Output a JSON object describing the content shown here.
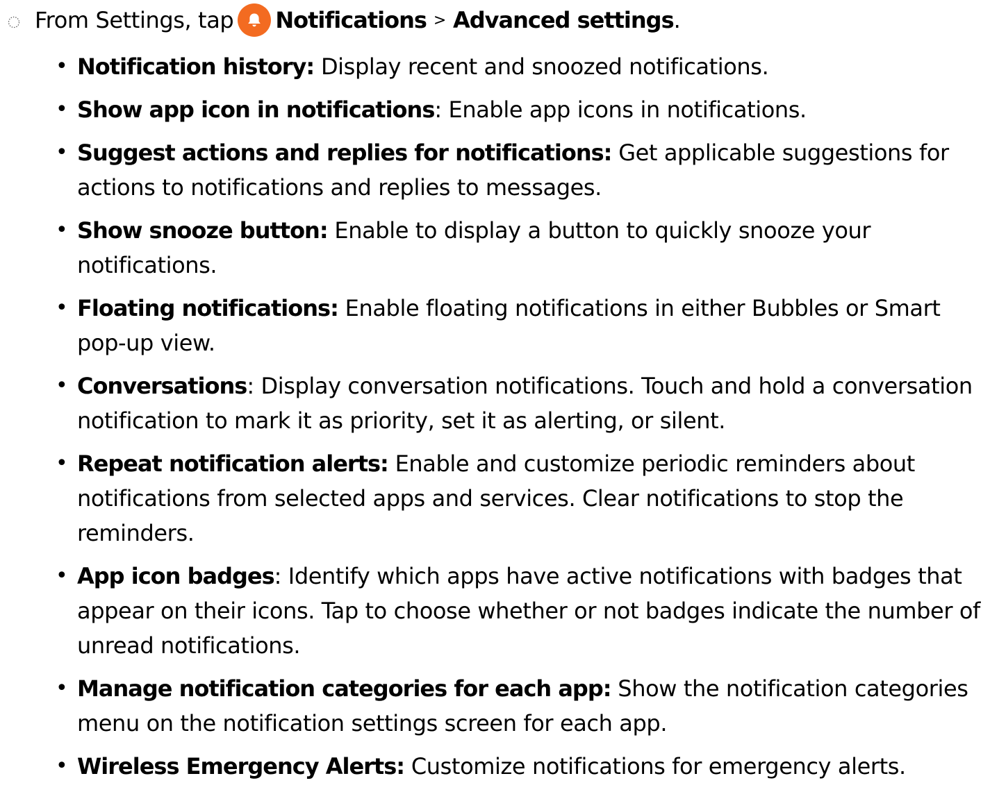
{
  "step": {
    "marker_icon": "dotted-circle-icon",
    "prefix": "From Settings, tap",
    "icon": "notifications-bell-icon",
    "icon_color": "#f36b21",
    "item1": "Notifications",
    "separator": ">",
    "item2": "Advanced settings",
    "end": "."
  },
  "bullets": [
    {
      "term": "Notification history:",
      "desc": " Display recent and snoozed notifications."
    },
    {
      "term": "Show app icon in notifications",
      "desc": ": Enable app icons in notifications."
    },
    {
      "term": "Suggest actions and replies for notifications:",
      "desc": " Get applicable suggestions for actions to notifications and replies to messages."
    },
    {
      "term": "Show snooze button:",
      "desc": " Enable to display a button to quickly snooze your notifications."
    },
    {
      "term": "Floating notifications:",
      "desc": " Enable floating notifications in either Bubbles or Smart pop-up view."
    },
    {
      "term": "Conversations",
      "desc": ": Display conversation notifications. Touch and hold a conversation notification to mark it as priority, set it as alerting, or silent."
    },
    {
      "term": "Repeat notification alerts:",
      "desc": " Enable and customize periodic reminders about notifications from selected apps and services. Clear notifications to stop the reminders."
    },
    {
      "term": "App icon badges",
      "desc": ": Identify which apps have active notifications with badges that appear on their icons. Tap to choose whether or not badges indicate the number of unread notifications."
    },
    {
      "term": "Manage notification categories for each app:",
      "desc": " Show the notification categories menu on the notification settings screen for each app."
    },
    {
      "term": "Wireless Emergency Alerts:",
      "desc": " Customize notifications for emergency alerts."
    }
  ]
}
